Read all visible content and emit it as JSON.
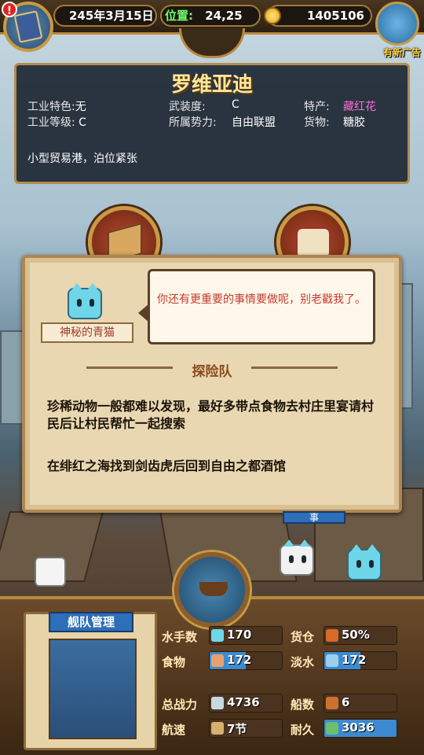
{
  "topbar": {
    "date": "245年3月15日",
    "position_label": "位置:",
    "position_value": "24,25",
    "gold": "1405106",
    "ad_label": "有新广告",
    "alert": "!"
  },
  "city": {
    "name": "罗维亚迪",
    "rows": [
      {
        "k": "工业特色:",
        "v": "无"
      },
      {
        "k": "工业等级:",
        "v": "C"
      },
      {
        "k": "武装度:",
        "v": "C"
      },
      {
        "k": "所属势力:",
        "v": "自由联盟"
      },
      {
        "k": "特产:",
        "v": "藏红花"
      },
      {
        "k": "货物:",
        "v": "糖胶"
      }
    ],
    "description": "小型贸易港，泊位紧张"
  },
  "dialog": {
    "speaker": "神秘的青猫",
    "speech": "你还有更重要的事情要做呢，别老戳我了。",
    "section_title": "探险队",
    "paragraph1": "珍稀动物一般都难以发现，最好多带点食物去村庄里宴请村民后让村民帮忙一起搜索",
    "paragraph2": "在绯红之海找到剑齿虎后回到自由之都酒馆"
  },
  "hidden_button_fragment": "事",
  "fleet": {
    "title": "舰队管理",
    "stats": [
      {
        "label": "水手数",
        "value": "170",
        "fill": 0.0,
        "icon": "sailor-icon"
      },
      {
        "label": "货仓",
        "value": "50%",
        "fill": 0.0,
        "icon": "cargo-icon"
      },
      {
        "label": "食物",
        "value": "172",
        "fill": 0.5,
        "icon": "food-icon"
      },
      {
        "label": "淡水",
        "value": "172",
        "fill": 0.5,
        "icon": "water-icon"
      },
      {
        "label": "总战力",
        "value": "4736",
        "fill": 0.0,
        "icon": "power-icon"
      },
      {
        "label": "船数",
        "value": "6",
        "fill": 0.0,
        "icon": "ship-count-icon"
      },
      {
        "label": "航速",
        "value": "7节",
        "fill": 0.0,
        "icon": "speed-icon"
      },
      {
        "label": "耐久",
        "value": "3036",
        "fill": 1.0,
        "icon": "durability-icon"
      }
    ]
  },
  "colors": {
    "accent": "#b98a3e",
    "speech_red": "#c23b2f",
    "stat_blue": "#3d8ad0",
    "highlight_pink": "#ff6bd0"
  }
}
